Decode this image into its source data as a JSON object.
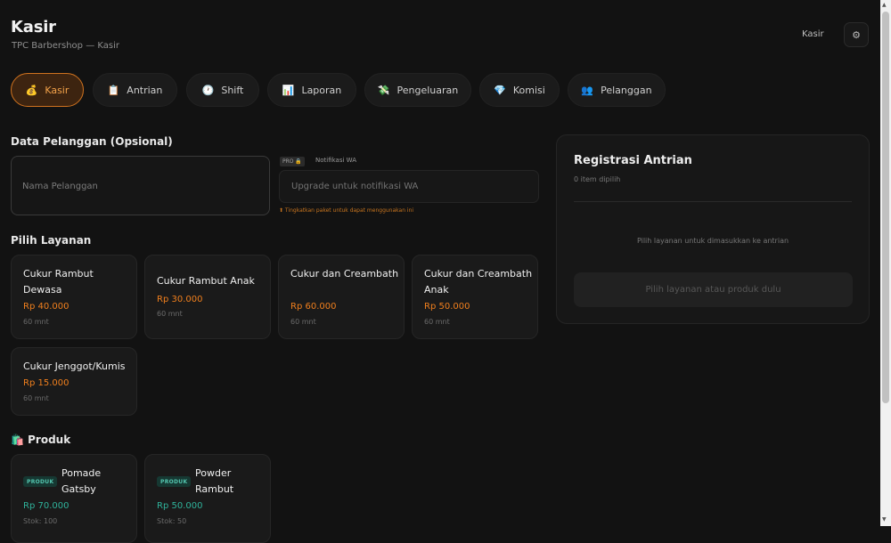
{
  "header": {
    "title": "Kasir",
    "subtitle": "TPC Barbershop — Kasir",
    "role": "Kasir",
    "settings_icon": "⚙"
  },
  "tabs": [
    {
      "label": "Kasir",
      "icon": "💰",
      "active": true
    },
    {
      "label": "Antrian",
      "icon": "📋"
    },
    {
      "label": "Shift",
      "icon": "🕐"
    },
    {
      "label": "Laporan",
      "icon": "📊"
    },
    {
      "label": "Pengeluaran",
      "icon": "💸"
    },
    {
      "label": "Komisi",
      "icon": "💎"
    },
    {
      "label": "Pelanggan",
      "icon": "👥"
    }
  ],
  "customer": {
    "section_title": "Data Pelanggan (Opsional)",
    "name_placeholder": "Nama Pelanggan",
    "pro_badge": "PRO 🔒",
    "wa_label": "Notifikasi WA",
    "wa_placeholder": "Upgrade untuk notifikasi WA",
    "wa_warning": "⬆ Tingkatkan paket untuk dapat menggunakan ini"
  },
  "services": {
    "section_title": "Pilih Layanan",
    "items": [
      {
        "name": "Cukur Rambut Dewasa",
        "price": "Rp 40.000",
        "duration": "60 mnt"
      },
      {
        "name": "Cukur Rambut Anak",
        "price": "Rp 30.000",
        "duration": "60 mnt"
      },
      {
        "name": "Cukur dan Creambath",
        "price": "Rp 60.000",
        "duration": "60 mnt"
      },
      {
        "name": "Cukur dan Creambath Anak",
        "price": "Rp 50.000",
        "duration": "60 mnt"
      },
      {
        "name": "Cukur Jenggot/Kumis",
        "price": "Rp 15.000",
        "duration": "60 mnt"
      }
    ]
  },
  "products": {
    "section_title": "🛍️ Produk",
    "badge": "PRODUK",
    "items": [
      {
        "name": "Pomade Gatsby",
        "price": "Rp 70.000",
        "stock": "Stok: 100"
      },
      {
        "name": "Powder Rambut",
        "price": "Rp 50.000",
        "stock": "Stok: 50"
      }
    ]
  },
  "queue_panel": {
    "title": "Registrasi Antrian",
    "selected": "0 item dipilih",
    "empty": "Pilih layanan untuk dimasukkan ke antrian",
    "button": "Pilih layanan atau produk dulu"
  },
  "colors": {
    "accent": "#f07f1d",
    "product_price": "#2fb39b",
    "background": "#121212"
  }
}
